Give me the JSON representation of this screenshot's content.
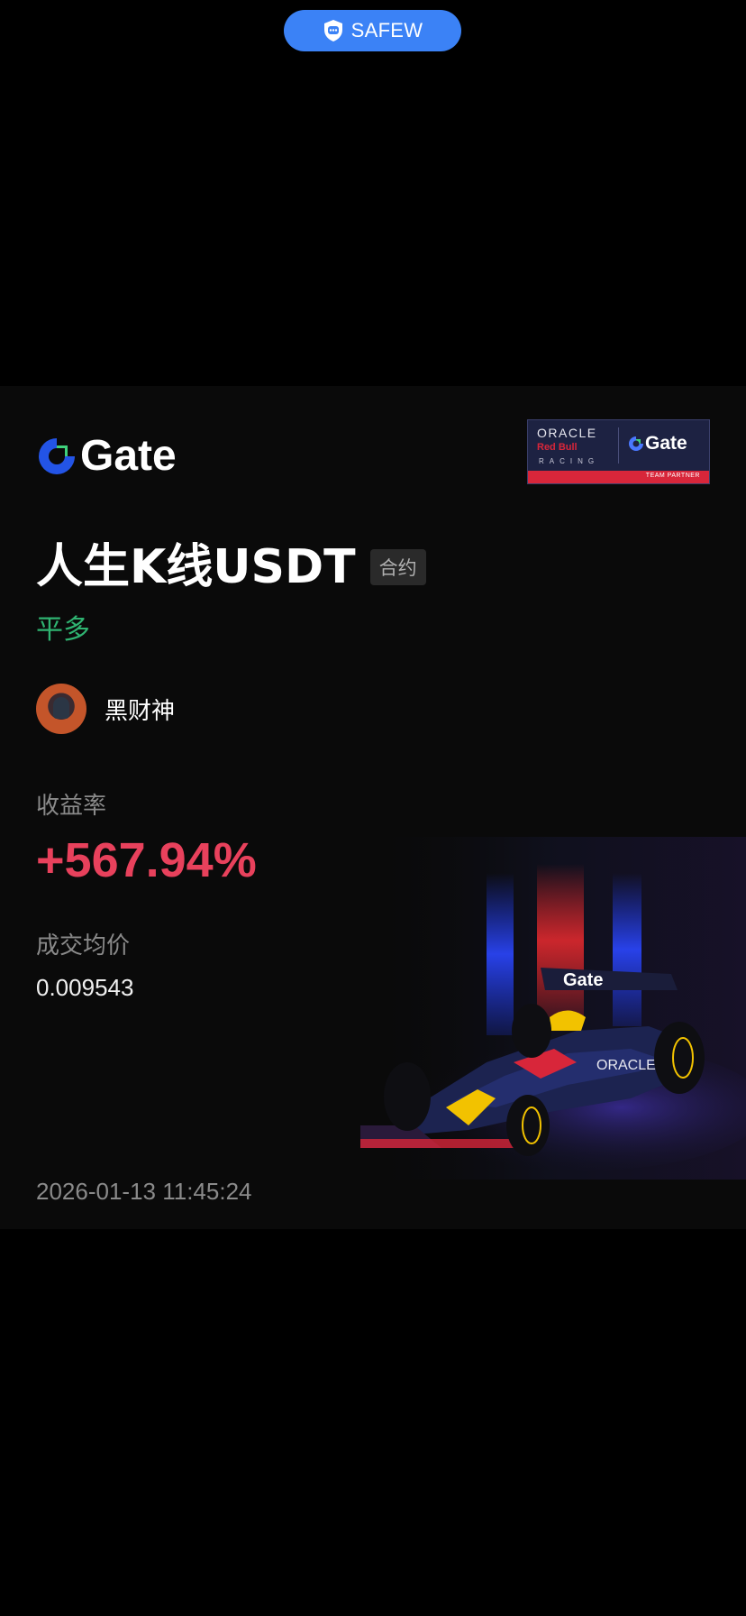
{
  "top_pill": {
    "label": "SAFEW",
    "icon": "chat-shield-icon",
    "color": "#3b82f6"
  },
  "card": {
    "logo_text": "Gate",
    "partner_badge": {
      "line1": "ORACLE",
      "line2": "Red Bull",
      "line3": "RACING",
      "logo": "Gate",
      "footer": "TEAM PARTNER"
    },
    "title": "人生K线USDT",
    "tag": "合约",
    "side": "平多",
    "user": {
      "name": "黑财神",
      "avatar": "avatar-icon"
    },
    "roi_label": "收益率",
    "roi_value": "+567.94%",
    "price_label": "成交均价",
    "price_value": "0.009543",
    "timestamp": "2026-01-13 11:45:24",
    "colors": {
      "positive": "#e8415c",
      "side": "#2fb371",
      "brand": "#2354e6"
    },
    "image": "f1-race-car"
  }
}
